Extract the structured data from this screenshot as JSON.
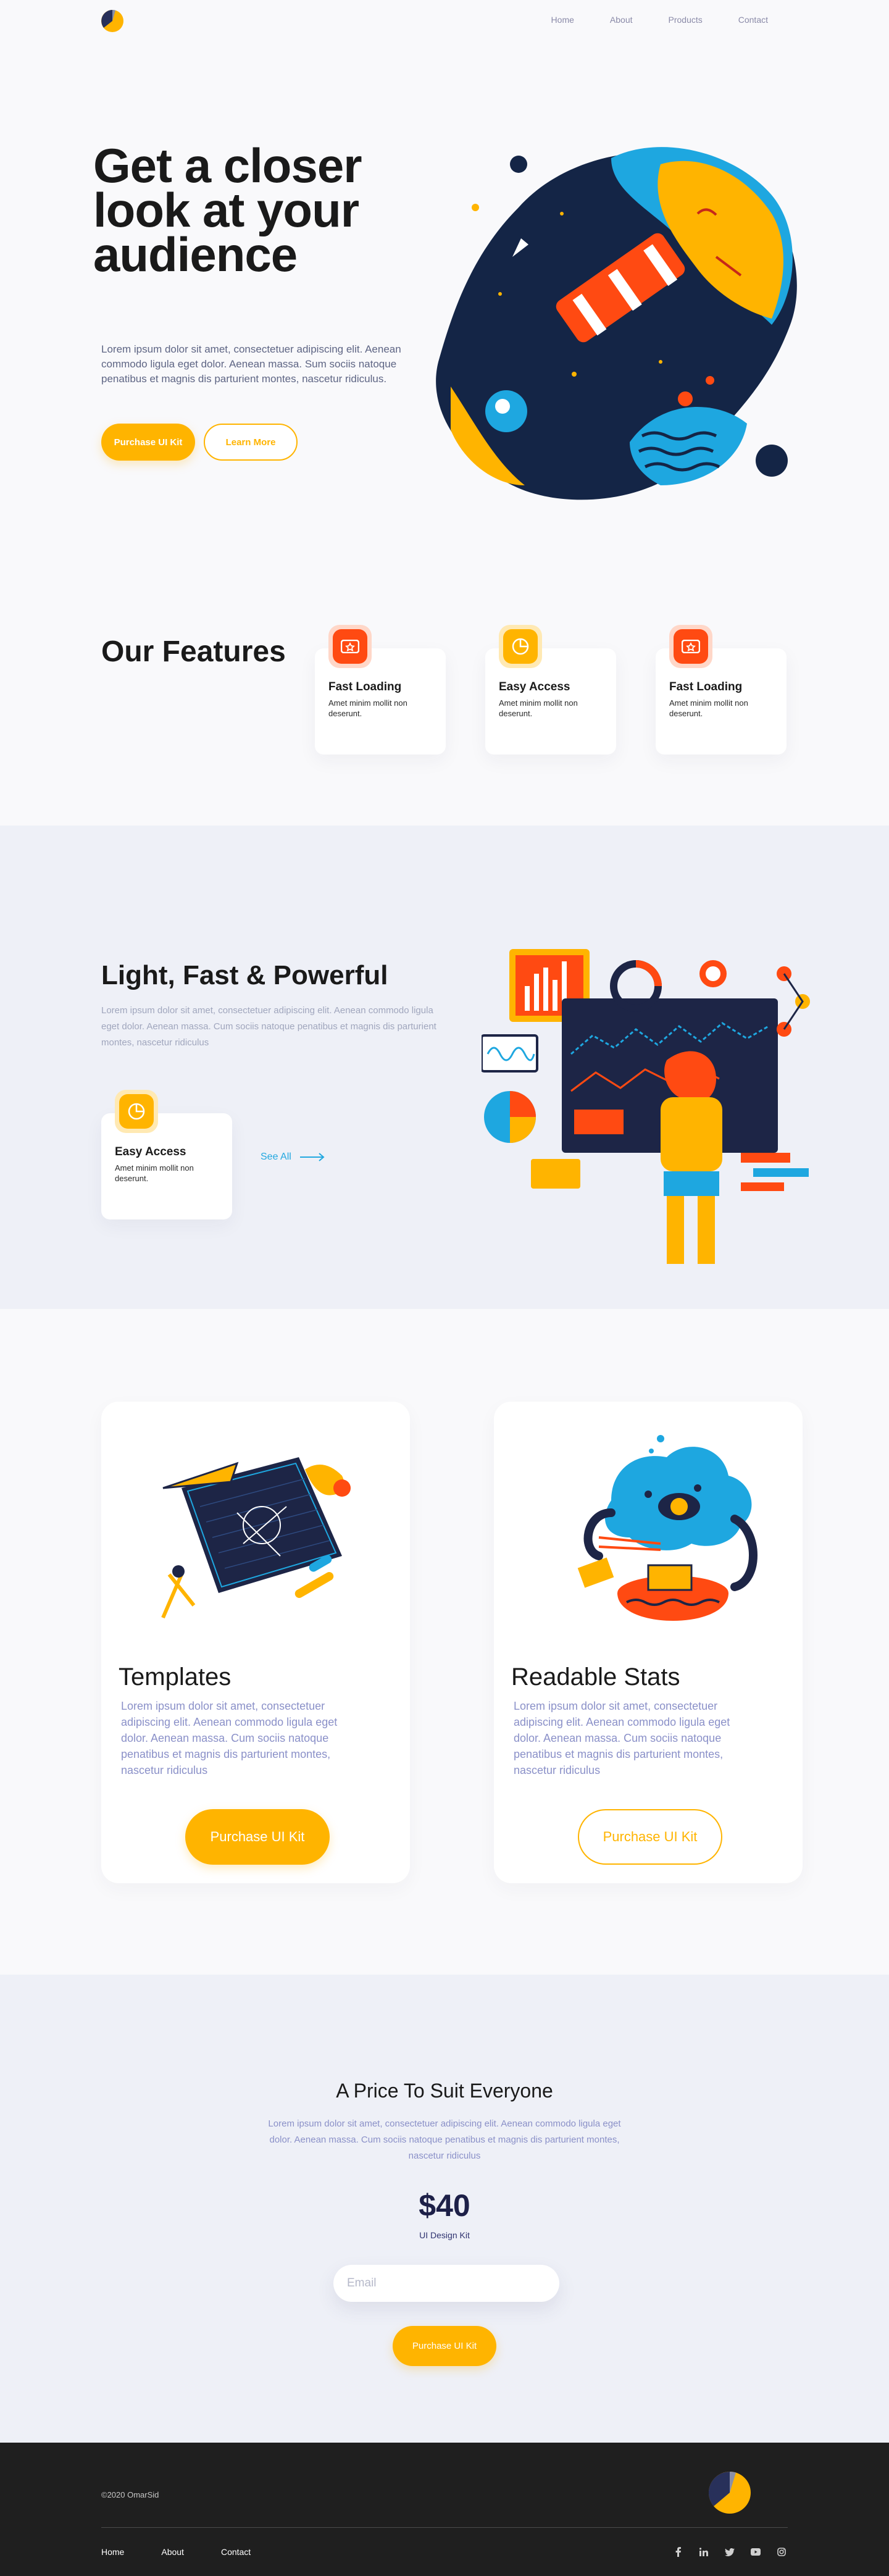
{
  "nav": {
    "links": [
      "Home",
      "About",
      "Products",
      "Contact"
    ]
  },
  "hero": {
    "title": "Get a closer look at your audience",
    "text": "Lorem ipsum dolor sit amet, consectetuer adipiscing elit. Aenean commodo ligula eget dolor. Aenean massa. Sum sociis natoque penatibus et magnis dis parturient montes, nascetur ridiculus.",
    "primary_btn": "Purchase UI Kit",
    "secondary_btn": "Learn More"
  },
  "features": {
    "title": "Our Features",
    "cards": [
      {
        "title": "Fast Loading",
        "text": "Amet minim mollit non deserunt.",
        "icon": "ticket-icon",
        "color": "#ff4a12"
      },
      {
        "title": "Easy Access",
        "text": "Amet minim mollit non deserunt.",
        "icon": "pie-chart-icon",
        "color": "#ffb400"
      },
      {
        "title": "Fast Loading",
        "text": "Amet minim mollit non deserunt.",
        "icon": "ticket-icon",
        "color": "#ff4a12"
      }
    ]
  },
  "light": {
    "title": "Light, Fast & Powerful",
    "text": "Lorem ipsum dolor sit amet, consectetuer adipiscing elit. Aenean commodo ligula eget dolor. Aenean massa. Cum sociis natoque penatibus et magnis dis parturient montes, nascetur ridiculus",
    "card": {
      "title": "Easy Access",
      "text": "Amet minim mollit non deserunt.",
      "icon": "pie-chart-icon",
      "color": "#ffb400"
    },
    "see_all": "See All"
  },
  "cards": [
    {
      "title": "Templates",
      "text": "Lorem ipsum dolor sit amet, consectetuer adipiscing elit. Aenean commodo ligula eget dolor. Aenean massa. Cum sociis natoque penatibus et magnis dis parturient montes, nascetur ridiculus",
      "button": "Purchase UI Kit"
    },
    {
      "title": "Readable Stats",
      "text": "Lorem ipsum dolor sit amet, consectetuer adipiscing elit. Aenean commodo ligula eget dolor. Aenean massa. Cum sociis natoque penatibus et magnis dis parturient montes, nascetur ridiculus",
      "button": "Purchase UI Kit"
    }
  ],
  "pricing": {
    "title": "A Price To Suit Everyone",
    "text": "Lorem ipsum dolor sit amet, consectetuer adipiscing elit. Aenean commodo ligula eget dolor. Aenean massa. Cum sociis natoque penatibus et magnis dis parturient montes, nascetur ridiculus",
    "price": "$40",
    "plan": "UI Design Kit",
    "email_placeholder": "Email",
    "button": "Purchase UI Kit"
  },
  "footer": {
    "copyright": "©2020 OmarSid",
    "links": [
      "Home",
      "About",
      "Contact"
    ],
    "social": [
      "facebook-icon",
      "linkedin-icon",
      "twitter-icon",
      "youtube-icon",
      "instagram-icon"
    ]
  },
  "colors": {
    "accent": "#ffb400",
    "orange": "#ff4a12",
    "navy": "#1d2048",
    "blue": "#22a8e0"
  }
}
